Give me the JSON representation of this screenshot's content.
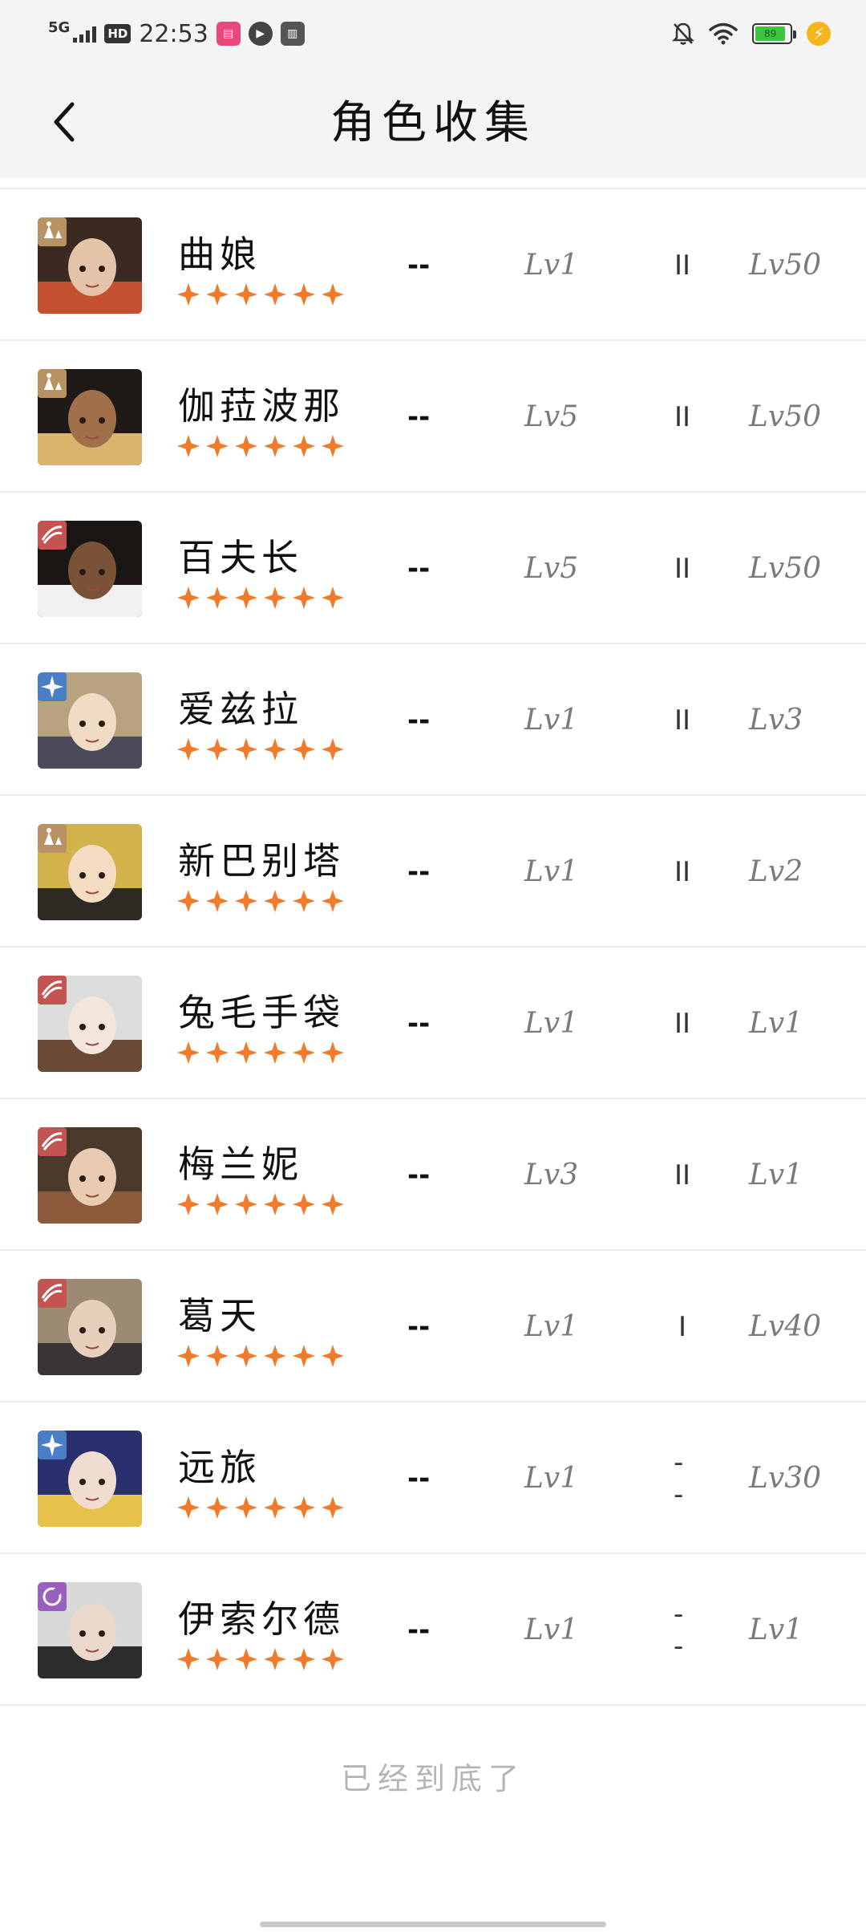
{
  "status_bar": {
    "network": "5G",
    "hd": "HD",
    "time": "22:53",
    "battery_percent": "89",
    "app_icons": [
      "bilibili-icon",
      "play-icon",
      "book-icon"
    ]
  },
  "header": {
    "title": "角色收集",
    "back_icon": "chevron-left-icon"
  },
  "colors": {
    "star": "#f27a2b",
    "class_dom": "#b99264",
    "class_war": "#c4544f",
    "class_ast": "#4a7fc8",
    "class_moon": "#9a5fc0"
  },
  "characters": [
    {
      "name": "曲娘",
      "stars": 6,
      "class": "dom",
      "col1": "--",
      "level": "Lv1",
      "insight": "II",
      "max_level": "Lv50",
      "palette": [
        "#3b2a22",
        "#e3c4a8",
        "#c4502f"
      ]
    },
    {
      "name": "伽菈波那",
      "stars": 6,
      "class": "dom",
      "col1": "--",
      "level": "Lv5",
      "insight": "II",
      "max_level": "Lv50",
      "palette": [
        "#1f1a17",
        "#a0704a",
        "#d9b46a"
      ]
    },
    {
      "name": "百夫长",
      "stars": 6,
      "class": "war",
      "col1": "--",
      "level": "Lv5",
      "insight": "II",
      "max_level": "Lv50",
      "palette": [
        "#1a1614",
        "#7a5238",
        "#f0f0f0"
      ]
    },
    {
      "name": "爱兹拉",
      "stars": 6,
      "class": "ast",
      "col1": "--",
      "level": "Lv1",
      "insight": "II",
      "max_level": "Lv3",
      "palette": [
        "#b9a27f",
        "#f0dcc4",
        "#4a4a5a"
      ]
    },
    {
      "name": "新巴别塔",
      "stars": 6,
      "class": "dom",
      "col1": "--",
      "level": "Lv1",
      "insight": "II",
      "max_level": "Lv2",
      "palette": [
        "#d1b24b",
        "#f3dcc2",
        "#2d2a24"
      ]
    },
    {
      "name": "兔毛手袋",
      "stars": 6,
      "class": "war",
      "col1": "--",
      "level": "Lv1",
      "insight": "II",
      "max_level": "Lv1",
      "palette": [
        "#dcdcdc",
        "#f2e6dc",
        "#6a4a34"
      ]
    },
    {
      "name": "梅兰妮",
      "stars": 6,
      "class": "war",
      "col1": "--",
      "level": "Lv3",
      "insight": "II",
      "max_level": "Lv1",
      "palette": [
        "#4b3a2c",
        "#e8cbb0",
        "#8a5a3a"
      ]
    },
    {
      "name": "葛天",
      "stars": 6,
      "class": "war",
      "col1": "--",
      "level": "Lv1",
      "insight": "I",
      "max_level": "Lv40",
      "palette": [
        "#9c8a74",
        "#e6d0bc",
        "#3a3434"
      ]
    },
    {
      "name": "远旅",
      "stars": 6,
      "class": "ast",
      "col1": "--",
      "level": "Lv1",
      "insight": "--",
      "max_level": "Lv30",
      "palette": [
        "#2a2f6e",
        "#f0dcd0",
        "#e6c24a"
      ]
    },
    {
      "name": "伊索尔德",
      "stars": 6,
      "class": "moon",
      "col1": "--",
      "level": "Lv1",
      "insight": "--",
      "max_level": "Lv1",
      "palette": [
        "#d8d8d8",
        "#ead8cc",
        "#2c2c2c"
      ]
    }
  ],
  "footer": {
    "end_text": "已经到底了"
  }
}
